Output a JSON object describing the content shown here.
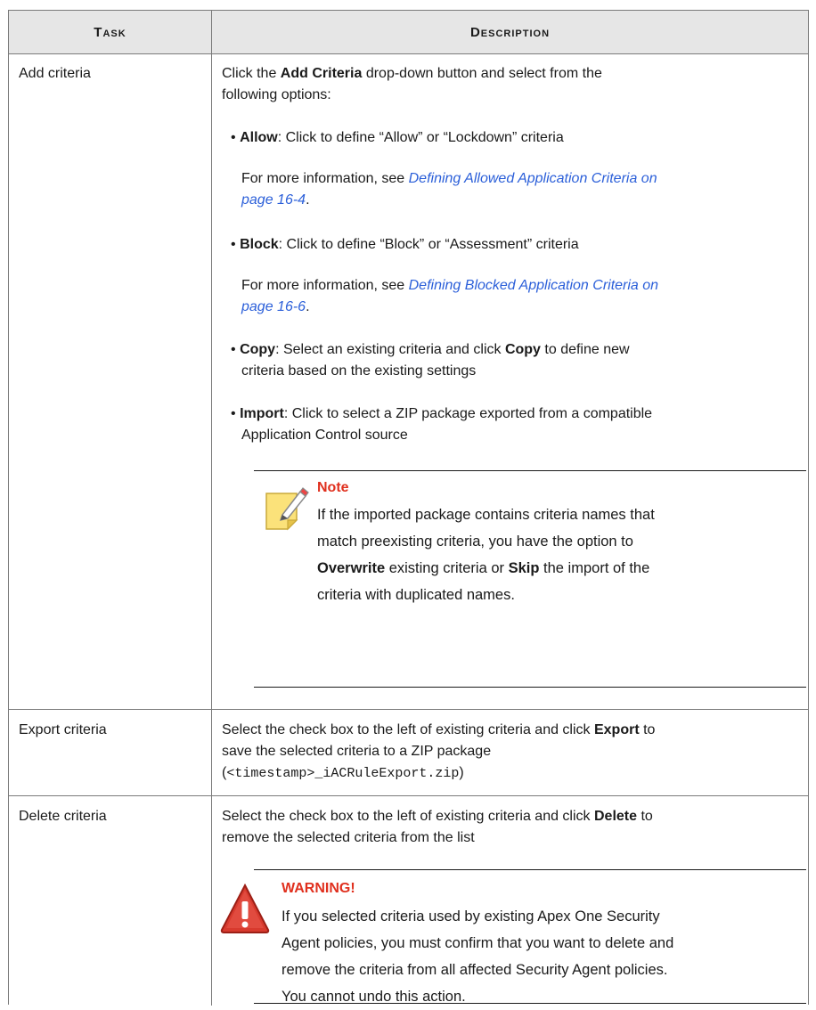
{
  "header": {
    "task": "Task",
    "description": "Description"
  },
  "rows": [
    {
      "task": "Add criteria",
      "intro_pre": "Click the ",
      "intro_bold": "Add Criteria",
      "intro_post": " drop-down button and select from the",
      "intro_line2": "following options:",
      "allow": {
        "label": "Allow",
        "text": ": Click to define “Allow” or “Lockdown” criteria",
        "more_pre": "For more information, see ",
        "link_line1": "Defining Allowed Application Criteria on",
        "link_line2": "page 16-4",
        "more_post": "."
      },
      "block": {
        "label": "Block",
        "text": ": Click to define “Block” or “Assessment” criteria",
        "more_pre": "For more information, see ",
        "link_line1": "Defining Blocked Application Criteria on",
        "link_line2": "page 16-6",
        "more_post": "."
      },
      "copy": {
        "label": "Copy",
        "text_pre": ": Select an existing criteria and click ",
        "text_bold": "Copy",
        "text_post": " to define new",
        "line2": "criteria based on the existing settings"
      },
      "import": {
        "label": "Import",
        "text": ": Click to select a ZIP package exported from a compatible",
        "line2": "Application Control source"
      },
      "note": {
        "title": "Note",
        "line1": "If the imported package contains criteria names that",
        "line2": "match preexisting criteria, you have the option to",
        "line3_b1": "Overwrite",
        "line3_mid": " existing criteria or ",
        "line3_b2": "Skip",
        "line3_post": " the import of the",
        "line4": "criteria with duplicated names."
      }
    },
    {
      "task": "Export criteria",
      "line1_pre": "Select the check box to the left of existing criteria and click ",
      "line1_bold": "Export",
      "line1_post": " to",
      "line2": "save the selected criteria to a ZIP package",
      "line3_open": "(",
      "line3_code": "<timestamp>_iACRuleExport.zip",
      "line3_close": ")"
    },
    {
      "task": "Delete criteria",
      "line1_pre": "Select the check box to the left of existing criteria and click ",
      "line1_bold": "Delete",
      "line1_post": " to",
      "line2": "remove the selected criteria from the list",
      "warning": {
        "title": "WARNING!",
        "line1": "If you selected criteria used by existing Apex One Security",
        "line2": "Agent policies, you must confirm that you want to delete and",
        "line3": "remove the criteria from all affected Security Agent policies.",
        "line4": "You cannot undo this action."
      }
    }
  ]
}
